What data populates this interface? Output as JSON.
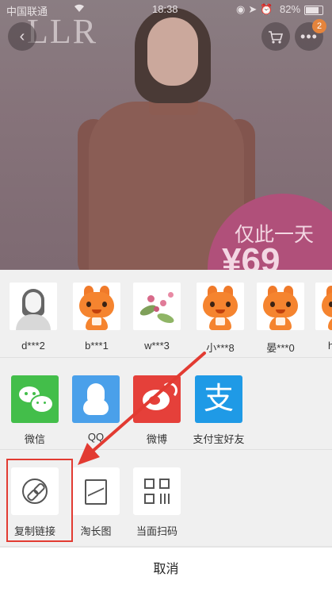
{
  "status_bar": {
    "carrier": "中国联通",
    "time": "18:38",
    "battery": "82%"
  },
  "product": {
    "brand_logo": "LLR",
    "promo_text": "仅此一天",
    "promo_price": "¥69",
    "cart_badge": "2"
  },
  "share_sheet": {
    "contacts": [
      {
        "name": "d***2",
        "avatar": "sketch"
      },
      {
        "name": "b***1",
        "avatar": "mascot"
      },
      {
        "name": "w***3",
        "avatar": "flower"
      },
      {
        "name": "小***8",
        "avatar": "mascot"
      },
      {
        "name": "晏***0",
        "avatar": "mascot"
      },
      {
        "name": "h",
        "avatar": "mascot"
      }
    ],
    "apps": [
      {
        "label": "微信",
        "icon": "wechat-icon",
        "color": "#43be4a"
      },
      {
        "label": "QQ",
        "icon": "qq-icon",
        "color": "#4aa0ea"
      },
      {
        "label": "微博",
        "icon": "weibo-icon",
        "color": "#e5403a"
      },
      {
        "label": "支付宝好友",
        "icon": "alipay-icon",
        "color": "#1f9ae6"
      }
    ],
    "tools": [
      {
        "label": "复制链接",
        "icon": "copy-link-icon"
      },
      {
        "label": "淘长图",
        "icon": "long-image-icon"
      },
      {
        "label": "当面扫码",
        "icon": "qr-code-icon"
      }
    ],
    "alipay_glyph": "支",
    "cancel_label": "取消"
  },
  "colors": {
    "annotation_red": "#e23b32"
  }
}
